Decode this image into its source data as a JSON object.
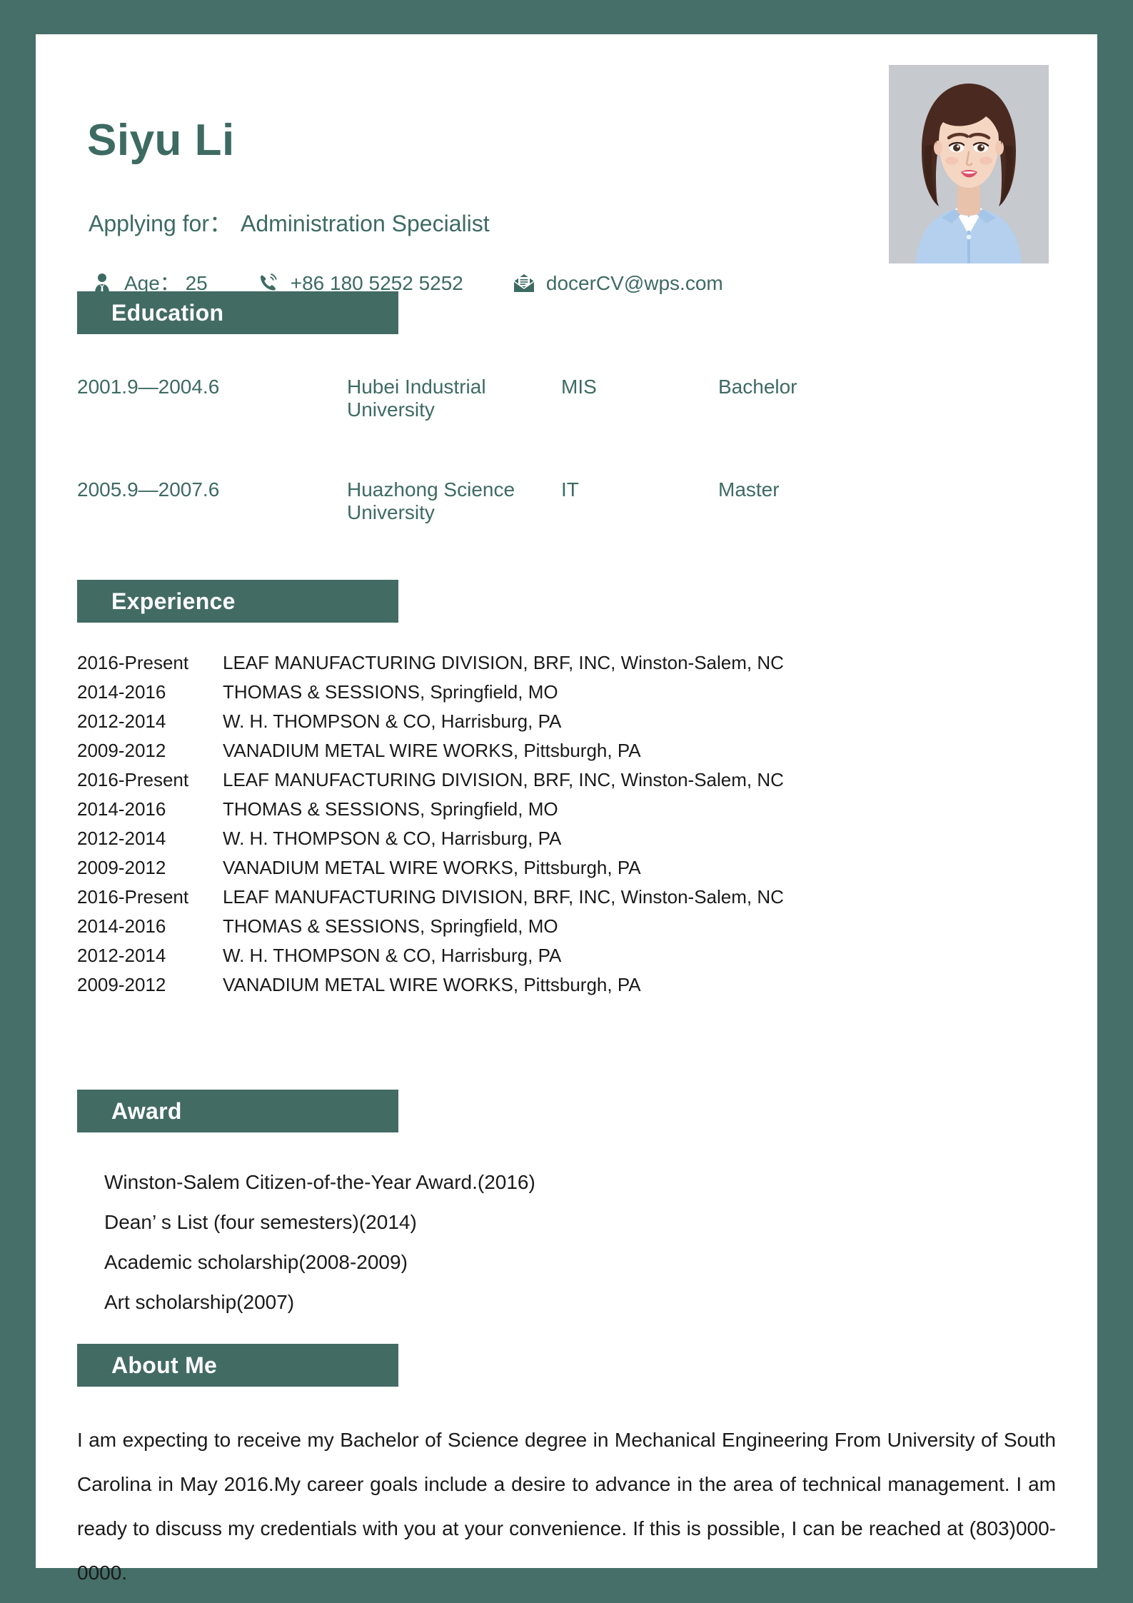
{
  "theme": {
    "border_color": "#456f68",
    "accent_color": "#426b64",
    "heading_text_color": "#3d6b62",
    "bar_label_color": "#ffffff",
    "body_text_color": "#1a1a1a"
  },
  "header": {
    "name": "Siyu Li",
    "applying_label": "Applying for：",
    "applying_role": "Administration Specialist",
    "photo_alt": "portrait-photo",
    "contacts": [
      {
        "icon": "person-tie-icon",
        "text": "Age： 25"
      },
      {
        "icon": "phone-icon",
        "text": "+86 180 5252 5252"
      },
      {
        "icon": "email-icon",
        "text": "docerCV@wps.com"
      }
    ]
  },
  "sections": {
    "education": {
      "title": "Education",
      "rows": [
        {
          "date": "2001.9—2004.6",
          "school": "Hubei Industrial University",
          "major": "MIS",
          "degree": "Bachelor"
        },
        {
          "date": "2005.9—2007.6",
          "school": "Huazhong Science University",
          "major": "IT",
          "degree": "Master"
        }
      ]
    },
    "experience": {
      "title": "Experience",
      "rows": [
        {
          "date": "2016-Present",
          "desc": "LEAF MANUFACTURING DIVISION, BRF, INC, Winston-Salem, NC"
        },
        {
          "date": "2014-2016",
          "desc": "THOMAS & SESSIONS, Springfield, MO"
        },
        {
          "date": "2012-2014",
          "desc": "  W. H. THOMPSON & CO, Harrisburg, PA"
        },
        {
          "date": "2009-2012",
          "desc": "VANADIUM METAL WIRE WORKS, Pittsburgh, PA"
        },
        {
          "date": "2016-Present",
          "desc": "LEAF MANUFACTURING DIVISION, BRF, INC, Winston-Salem, NC"
        },
        {
          "date": "2014-2016",
          "desc": "THOMAS & SESSIONS, Springfield, MO"
        },
        {
          "date": "2012-2014",
          "desc": "  W. H. THOMPSON & CO, Harrisburg, PA"
        },
        {
          "date": "2009-2012",
          "desc": "VANADIUM METAL WIRE WORKS, Pittsburgh, PA"
        },
        {
          "date": "2016-Present",
          "desc": "LEAF MANUFACTURING DIVISION, BRF, INC, Winston-Salem, NC"
        },
        {
          "date": "2014-2016",
          "desc": "THOMAS & SESSIONS, Springfield, MO"
        },
        {
          "date": "2012-2014",
          "desc": "  W. H. THOMPSON & CO, Harrisburg, PA"
        },
        {
          "date": "2009-2012",
          "desc": "VANADIUM METAL WIRE WORKS, Pittsburgh, PA"
        }
      ]
    },
    "award": {
      "title": "Award",
      "rows": [
        "Winston-Salem Citizen-of-the-Year Award.(2016)",
        "Dean’ s List (four semesters)(2014)",
        "Academic scholarship(2008-2009)",
        "Art scholarship(2007)"
      ]
    },
    "about": {
      "title": "About Me",
      "text": "I am expecting to receive my Bachelor of Science degree in Mechanical Engineering From University of South Carolina in May 2016.My career goals include a desire to advance in the area of technical management. I am ready to discuss my credentials with you at your convenience. If this is possible, I can be reached at (803)000-0000."
    }
  }
}
